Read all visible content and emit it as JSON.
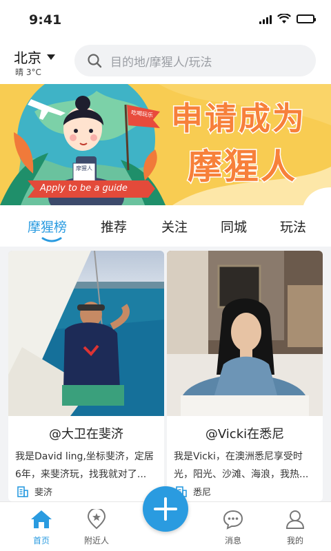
{
  "status_bar": {
    "time": "9:41"
  },
  "header": {
    "city": "北京",
    "weather": "晴 3°C",
    "search_placeholder": "目的地/摩猩人/玩法"
  },
  "banner": {
    "headline_line1": "申请成为",
    "headline_line2": "摩猩人",
    "ribbon_text": "Apply to be a guide",
    "flag_text": "吃喝玩乐",
    "badge_text": "摩猩人"
  },
  "tabs": [
    {
      "label": "摩猩榜",
      "active": true
    },
    {
      "label": "推荐",
      "active": false
    },
    {
      "label": "关注",
      "active": false
    },
    {
      "label": "同城",
      "active": false
    },
    {
      "label": "玩法",
      "active": false
    }
  ],
  "cards": [
    {
      "name": "@大卫在斐济",
      "description": "我是David ling,坐标斐济，定居6年，来斐济玩，找我就对了...",
      "location": "斐济"
    },
    {
      "name": "@Vicki在悉尼",
      "description": "我是Vicki，在澳洲悉尼享受时光，阳光、沙滩、海浪，我热...",
      "location": "悉尼"
    }
  ],
  "bottom_nav": [
    {
      "label": "首页",
      "icon": "home-icon",
      "active": true
    },
    {
      "label": "附近人",
      "icon": "nearby-location-icon",
      "active": false
    },
    {
      "label": "消息",
      "icon": "message-icon",
      "active": false
    },
    {
      "label": "我的",
      "icon": "profile-icon",
      "active": false
    }
  ],
  "colors": {
    "accent": "#2a9be0",
    "banner_bg": "#f8cc52",
    "banner_text": "#f7803a"
  }
}
